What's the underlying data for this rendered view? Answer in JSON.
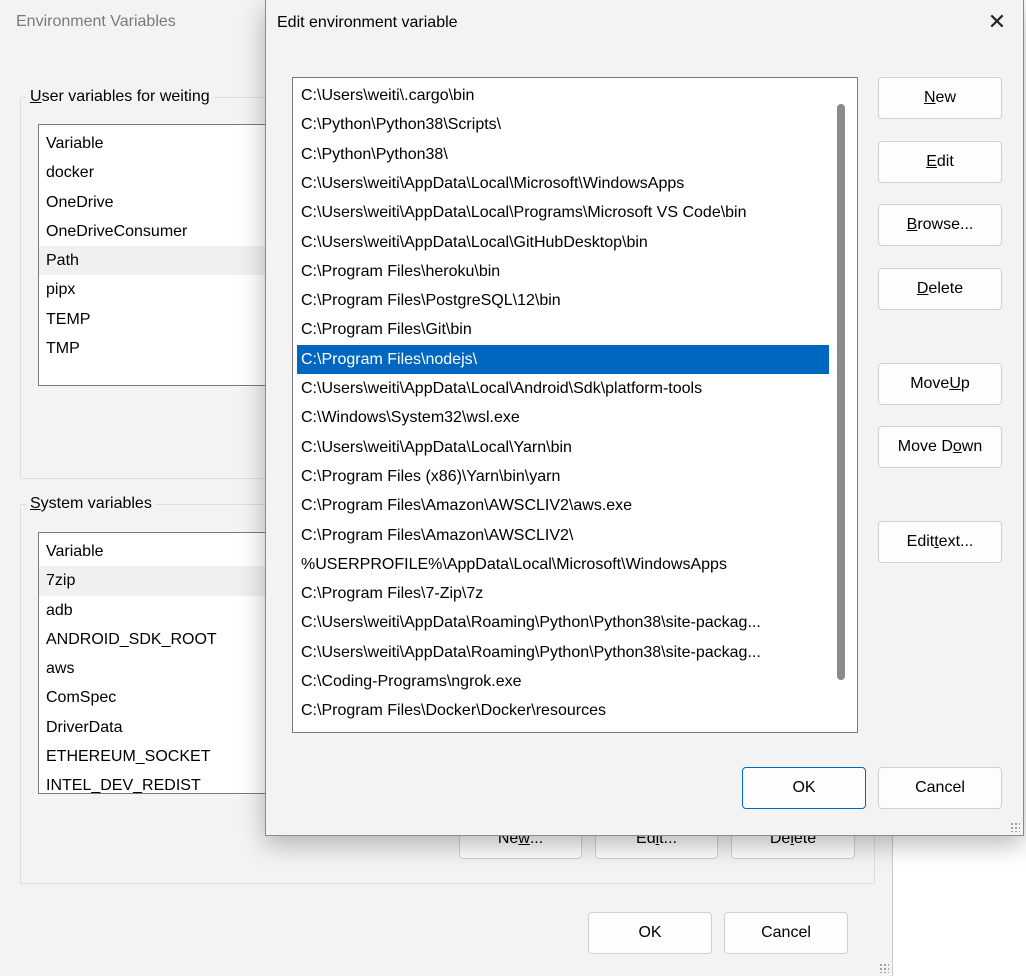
{
  "bg_window": {
    "title": "Environment Variables",
    "user_group": {
      "label": "User variables for weiting",
      "label_underline": "U",
      "label_rest": "ser variables for weiting",
      "header": "Variable",
      "rows": [
        "docker",
        "OneDrive",
        "OneDriveConsumer",
        "Path",
        "pipx",
        "TEMP",
        "TMP"
      ],
      "selected_index": 3
    },
    "system_group": {
      "label": "System variables",
      "label_underline": "S",
      "label_rest": "ystem variables",
      "header": "Variable",
      "rows": [
        "7zip",
        "adb",
        "ANDROID_SDK_ROOT",
        "aws",
        "ComSpec",
        "DriverData",
        "ETHEREUM_SOCKET",
        "INTEL_DEV_REDIST"
      ],
      "selected_index": 0
    },
    "system_buttons": {
      "new": {
        "pre": "Ne",
        "u": "w",
        "post": "..."
      },
      "edit": {
        "pre": "Ed",
        "u": "i",
        "post": "t..."
      },
      "delete": {
        "pre": "De",
        "u": "l",
        "post": "ete"
      }
    },
    "ok_label": "OK",
    "cancel_label": "Cancel"
  },
  "dialog": {
    "title": "Edit environment variable",
    "close_icon": "close-icon",
    "paths": [
      "C:\\Users\\weiti\\.cargo\\bin",
      "C:\\Python\\Python38\\Scripts\\",
      "C:\\Python\\Python38\\",
      "C:\\Users\\weiti\\AppData\\Local\\Microsoft\\WindowsApps",
      "C:\\Users\\weiti\\AppData\\Local\\Programs\\Microsoft VS Code\\bin",
      "C:\\Users\\weiti\\AppData\\Local\\GitHubDesktop\\bin",
      "C:\\Program Files\\heroku\\bin",
      "C:\\Program Files\\PostgreSQL\\12\\bin",
      "C:\\Program Files\\Git\\bin",
      "C:\\Program Files\\nodejs\\",
      "C:\\Users\\weiti\\AppData\\Local\\Android\\Sdk\\platform-tools",
      "C:\\Windows\\System32\\wsl.exe",
      "C:\\Users\\weiti\\AppData\\Local\\Yarn\\bin",
      "C:\\Program Files (x86)\\Yarn\\bin\\yarn",
      "C:\\Program Files\\Amazon\\AWSCLIV2\\aws.exe",
      "C:\\Program Files\\Amazon\\AWSCLIV2\\",
      "%USERPROFILE%\\AppData\\Local\\Microsoft\\WindowsApps",
      "C:\\Program Files\\7-Zip\\7z",
      "C:\\Users\\weiti\\AppData\\Roaming\\Python\\Python38\\site-packag...",
      "C:\\Users\\weiti\\AppData\\Roaming\\Python\\Python38\\site-packag...",
      "C:\\Coding-Programs\\ngrok.exe",
      "C:\\Program Files\\Docker\\Docker\\resources"
    ],
    "selected_index": 9,
    "buttons": {
      "new": {
        "pre": "",
        "u": "N",
        "post": "ew"
      },
      "edit": {
        "pre": "",
        "u": "E",
        "post": "dit"
      },
      "browse": {
        "pre": "",
        "u": "B",
        "post": "rowse..."
      },
      "delete": {
        "pre": "",
        "u": "D",
        "post": "elete"
      },
      "move_up": {
        "pre": "Move ",
        "u": "U",
        "post": "p"
      },
      "move_down": {
        "pre": "Move D",
        "u": "o",
        "post": "wn"
      },
      "edit_text": {
        "pre": "Edit ",
        "u": "t",
        "post": "ext..."
      }
    },
    "ok_label": "OK",
    "cancel_label": "Cancel"
  },
  "colors": {
    "selection": "#0067c0",
    "window_bg": "#f3f3f3",
    "list_bg": "#ffffff"
  }
}
